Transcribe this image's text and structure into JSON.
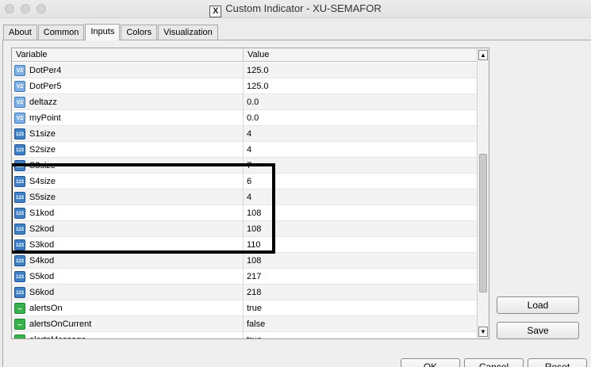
{
  "window": {
    "title": "Custom Indicator - XU-SEMAFOR",
    "app_icon": "X"
  },
  "tabs": [
    {
      "label": "About",
      "active": false
    },
    {
      "label": "Common",
      "active": false
    },
    {
      "label": "Inputs",
      "active": true
    },
    {
      "label": "Colors",
      "active": false
    },
    {
      "label": "Visualization",
      "active": false
    }
  ],
  "grid": {
    "headers": {
      "variable": "Variable",
      "value": "Value"
    },
    "rows": [
      {
        "icon": "double-value-icon",
        "icon_text": "V2",
        "name": "DotPer4",
        "value": "125.0"
      },
      {
        "icon": "double-value-icon",
        "icon_text": "V2",
        "name": "DotPer5",
        "value": "125.0"
      },
      {
        "icon": "double-value-icon",
        "icon_text": "V2",
        "name": "deltazz",
        "value": "0.0"
      },
      {
        "icon": "double-value-icon",
        "icon_text": "V2",
        "name": "myPoint",
        "value": "0.0"
      },
      {
        "icon": "integer-icon",
        "icon_text": "123",
        "name": "S1size",
        "value": "4"
      },
      {
        "icon": "integer-icon",
        "icon_text": "123",
        "name": "S2size",
        "value": "4"
      },
      {
        "icon": "integer-icon",
        "icon_text": "123",
        "name": "S3size",
        "value": "7"
      },
      {
        "icon": "integer-icon",
        "icon_text": "123",
        "name": "S4size",
        "value": "6"
      },
      {
        "icon": "integer-icon",
        "icon_text": "123",
        "name": "S5size",
        "value": "4"
      },
      {
        "icon": "integer-icon",
        "icon_text": "123",
        "name": "S1kod",
        "value": "108"
      },
      {
        "icon": "integer-icon",
        "icon_text": "123",
        "name": "S2kod",
        "value": "108"
      },
      {
        "icon": "integer-icon",
        "icon_text": "123",
        "name": "S3kod",
        "value": "110"
      },
      {
        "icon": "integer-icon",
        "icon_text": "123",
        "name": "S4kod",
        "value": "108"
      },
      {
        "icon": "integer-icon",
        "icon_text": "123",
        "name": "S5kod",
        "value": "217"
      },
      {
        "icon": "integer-icon",
        "icon_text": "123",
        "name": "S6kod",
        "value": "218"
      },
      {
        "icon": "boolean-icon",
        "icon_text": "~",
        "name": "alertsOn",
        "value": "true"
      },
      {
        "icon": "boolean-icon",
        "icon_text": "~",
        "name": "alertsOnCurrent",
        "value": "false"
      },
      {
        "icon": "boolean-icon",
        "icon_text": "~",
        "name": "alertsMessage",
        "value": "true"
      }
    ]
  },
  "buttons": {
    "load": "Load",
    "save": "Save",
    "ok": "OK",
    "cancel": "Cancel",
    "reset": "Reset"
  },
  "colors": {
    "highlight_border": "#000000",
    "integer_icon": "#3f7fc4",
    "double_icon": "#7fb1e6",
    "boolean_icon": "#37b24d"
  }
}
